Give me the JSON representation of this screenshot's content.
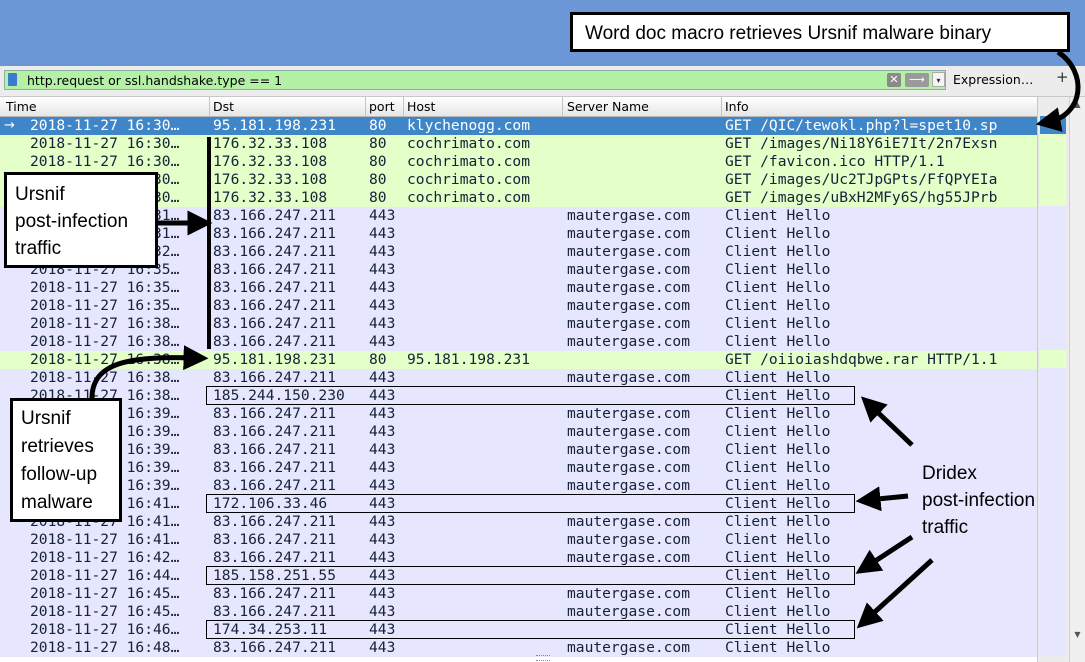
{
  "filter": {
    "text": "http.request or ssl.handshake.type == 1",
    "clear_label": "✕",
    "apply_label": "⟶",
    "dropdown_label": "▾",
    "expression_label": "Expression…",
    "plus_label": "+"
  },
  "columns": {
    "time": "Time",
    "dst": "Dst",
    "port": "port",
    "host": "Host",
    "server_name": "Server Name",
    "info": "Info"
  },
  "packets": [
    {
      "marker": "→",
      "time": "2018-11-27 16:30…",
      "dst": "95.181.198.231",
      "port": "80",
      "host": "klychenogg.com",
      "server": "",
      "info": "GET /QIC/tewokl.php?l=spet10.sp",
      "kind": "selected"
    },
    {
      "marker": "",
      "time": "2018-11-27 16:30…",
      "dst": "176.32.33.108",
      "port": "80",
      "host": "cochrimato.com",
      "server": "",
      "info": "GET /images/Ni18Y6iE7It/2n7Exsn",
      "kind": "http"
    },
    {
      "marker": "",
      "time": "2018-11-27 16:30…",
      "dst": "176.32.33.108",
      "port": "80",
      "host": "cochrimato.com",
      "server": "",
      "info": "GET /favicon.ico HTTP/1.1",
      "kind": "http"
    },
    {
      "marker": "",
      "time": "2018-11-27 16:30…",
      "dst": "176.32.33.108",
      "port": "80",
      "host": "cochrimato.com",
      "server": "",
      "info": "GET /images/Uc2TJpGPts/FfQPYEIa",
      "kind": "http"
    },
    {
      "marker": "",
      "time": "2018-11-27 16:30…",
      "dst": "176.32.33.108",
      "port": "80",
      "host": "cochrimato.com",
      "server": "",
      "info": "GET /images/uBxH2MFy6S/hg55JPrb",
      "kind": "http"
    },
    {
      "marker": "",
      "time": "2018-11-27 16:31…",
      "dst": "83.166.247.211",
      "port": "443",
      "host": "",
      "server": "mautergase.com",
      "info": "Client Hello",
      "kind": "tls"
    },
    {
      "marker": "",
      "time": "2018-11-27 16:31…",
      "dst": "83.166.247.211",
      "port": "443",
      "host": "",
      "server": "mautergase.com",
      "info": "Client Hello",
      "kind": "tls"
    },
    {
      "marker": "",
      "time": "2018-11-27 16:32…",
      "dst": "83.166.247.211",
      "port": "443",
      "host": "",
      "server": "mautergase.com",
      "info": "Client Hello",
      "kind": "tls"
    },
    {
      "marker": "",
      "time": "2018-11-27 16:35…",
      "dst": "83.166.247.211",
      "port": "443",
      "host": "",
      "server": "mautergase.com",
      "info": "Client Hello",
      "kind": "tls"
    },
    {
      "marker": "",
      "time": "2018-11-27 16:35…",
      "dst": "83.166.247.211",
      "port": "443",
      "host": "",
      "server": "mautergase.com",
      "info": "Client Hello",
      "kind": "tls"
    },
    {
      "marker": "",
      "time": "2018-11-27 16:35…",
      "dst": "83.166.247.211",
      "port": "443",
      "host": "",
      "server": "mautergase.com",
      "info": "Client Hello",
      "kind": "tls"
    },
    {
      "marker": "",
      "time": "2018-11-27 16:38…",
      "dst": "83.166.247.211",
      "port": "443",
      "host": "",
      "server": "mautergase.com",
      "info": "Client Hello",
      "kind": "tls"
    },
    {
      "marker": "",
      "time": "2018-11-27 16:38…",
      "dst": "83.166.247.211",
      "port": "443",
      "host": "",
      "server": "mautergase.com",
      "info": "Client Hello",
      "kind": "tls"
    },
    {
      "marker": "",
      "time": "2018-11-27 16:38…",
      "dst": "95.181.198.231",
      "port": "80",
      "host": "95.181.198.231",
      "server": "",
      "info": "GET /oiioiashdqbwe.rar HTTP/1.1",
      "kind": "http"
    },
    {
      "marker": "",
      "time": "2018-11-27 16:38…",
      "dst": "83.166.247.211",
      "port": "443",
      "host": "",
      "server": "mautergase.com",
      "info": "Client Hello",
      "kind": "tls"
    },
    {
      "marker": "",
      "time": "2018-11-27 16:38…",
      "dst": "185.244.150.230",
      "port": "443",
      "host": "",
      "server": "",
      "info": "Client Hello",
      "kind": "tls"
    },
    {
      "marker": "",
      "time": "2018-11-27 16:39…",
      "dst": "83.166.247.211",
      "port": "443",
      "host": "",
      "server": "mautergase.com",
      "info": "Client Hello",
      "kind": "tls"
    },
    {
      "marker": "",
      "time": "2018-11-27 16:39…",
      "dst": "83.166.247.211",
      "port": "443",
      "host": "",
      "server": "mautergase.com",
      "info": "Client Hello",
      "kind": "tls"
    },
    {
      "marker": "",
      "time": "2018-11-27 16:39…",
      "dst": "83.166.247.211",
      "port": "443",
      "host": "",
      "server": "mautergase.com",
      "info": "Client Hello",
      "kind": "tls"
    },
    {
      "marker": "",
      "time": "2018-11-27 16:39…",
      "dst": "83.166.247.211",
      "port": "443",
      "host": "",
      "server": "mautergase.com",
      "info": "Client Hello",
      "kind": "tls"
    },
    {
      "marker": "",
      "time": "2018-11-27 16:39…",
      "dst": "83.166.247.211",
      "port": "443",
      "host": "",
      "server": "mautergase.com",
      "info": "Client Hello",
      "kind": "tls"
    },
    {
      "marker": "",
      "time": "2018-11-27 16:41…",
      "dst": "172.106.33.46",
      "port": "443",
      "host": "",
      "server": "",
      "info": "Client Hello",
      "kind": "tls"
    },
    {
      "marker": "",
      "time": "2018-11-27 16:41…",
      "dst": "83.166.247.211",
      "port": "443",
      "host": "",
      "server": "mautergase.com",
      "info": "Client Hello",
      "kind": "tls"
    },
    {
      "marker": "",
      "time": "2018-11-27 16:41…",
      "dst": "83.166.247.211",
      "port": "443",
      "host": "",
      "server": "mautergase.com",
      "info": "Client Hello",
      "kind": "tls"
    },
    {
      "marker": "",
      "time": "2018-11-27 16:42…",
      "dst": "83.166.247.211",
      "port": "443",
      "host": "",
      "server": "mautergase.com",
      "info": "Client Hello",
      "kind": "tls"
    },
    {
      "marker": "",
      "time": "2018-11-27 16:44…",
      "dst": "185.158.251.55",
      "port": "443",
      "host": "",
      "server": "",
      "info": "Client Hello",
      "kind": "tls"
    },
    {
      "marker": "",
      "time": "2018-11-27 16:45…",
      "dst": "83.166.247.211",
      "port": "443",
      "host": "",
      "server": "mautergase.com",
      "info": "Client Hello",
      "kind": "tls"
    },
    {
      "marker": "",
      "time": "2018-11-27 16:45…",
      "dst": "83.166.247.211",
      "port": "443",
      "host": "",
      "server": "mautergase.com",
      "info": "Client Hello",
      "kind": "tls"
    },
    {
      "marker": "",
      "time": "2018-11-27 16:46…",
      "dst": "174.34.253.11",
      "port": "443",
      "host": "",
      "server": "",
      "info": "Client Hello",
      "kind": "tls"
    },
    {
      "marker": "",
      "time": "2018-11-27 16:48…",
      "dst": "83.166.247.211",
      "port": "443",
      "host": "",
      "server": "mautergase.com",
      "info": "Client Hello",
      "kind": "tls"
    }
  ],
  "annotations": {
    "word_doc": "Word doc macro retrieves Ursnif malware binary",
    "ursnif_post_infection": [
      "Ursnif",
      "post-infection",
      "traffic"
    ],
    "ursnif_followup": [
      "Ursnif",
      "retrieves",
      "follow-up",
      "malware"
    ],
    "dridex": [
      "Dridex",
      "post-infection",
      "traffic"
    ]
  },
  "colors": {
    "titlebar": "#6b97d6",
    "filter_valid": "#b4f0a6",
    "http_row": "#e4ffc7",
    "tls_row": "#e7e6ff",
    "selected_row": "#3f86c8"
  }
}
